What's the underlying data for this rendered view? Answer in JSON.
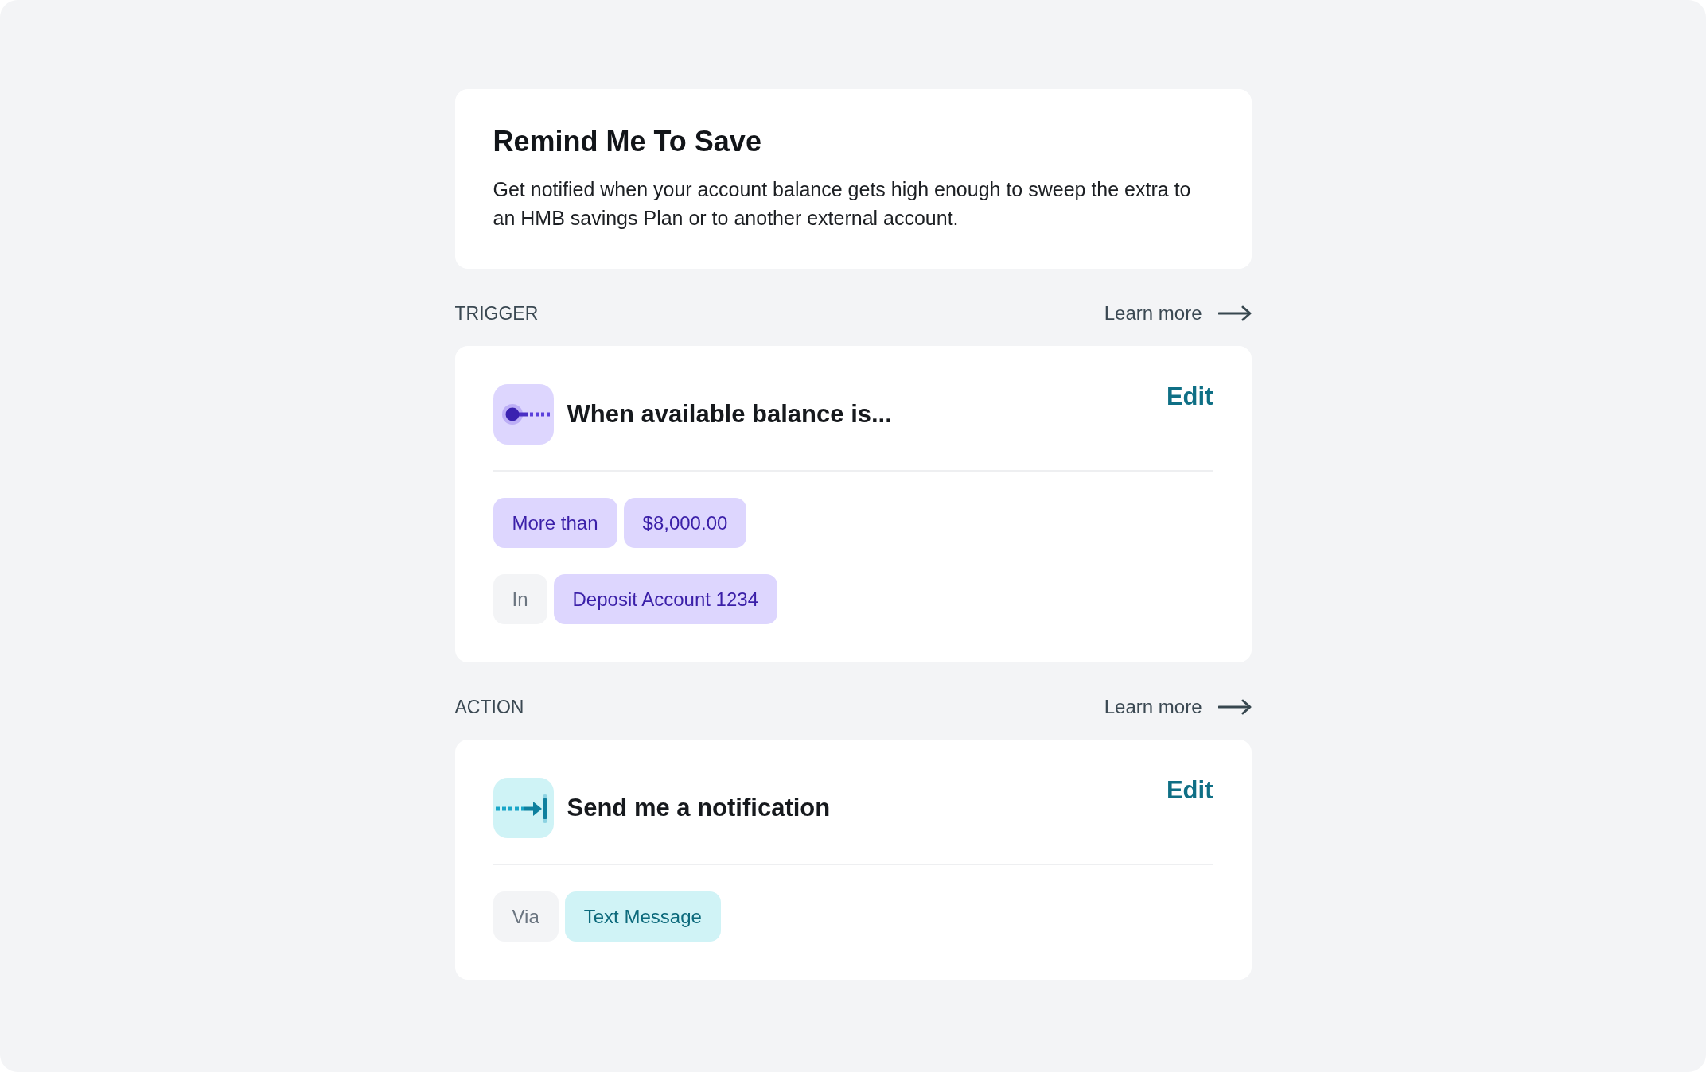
{
  "intro": {
    "title": "Remind Me To Save",
    "description": "Get notified when your account balance gets high enough to sweep the extra to an HMB savings Plan or to another external account."
  },
  "sections": [
    {
      "label": "TRIGGER",
      "link": "Learn more",
      "card": {
        "kind": "trigger",
        "heading": "When available balance is...",
        "edit": "Edit",
        "rows": [
          {
            "chips": [
              {
                "kind": "value",
                "text": "More than"
              },
              {
                "kind": "value",
                "text": "$8,000.00"
              }
            ]
          },
          {
            "chips": [
              {
                "kind": "prefix",
                "text": "In"
              },
              {
                "kind": "value",
                "text": "Deposit Account 1234"
              }
            ]
          }
        ]
      }
    },
    {
      "label": "ACTION",
      "link": "Learn more",
      "card": {
        "kind": "action",
        "heading": "Send me a notification",
        "edit": "Edit",
        "rows": [
          {
            "chips": [
              {
                "kind": "prefix",
                "text": "Via"
              },
              {
                "kind": "value",
                "text": "Text Message"
              }
            ]
          }
        ]
      }
    }
  ]
}
